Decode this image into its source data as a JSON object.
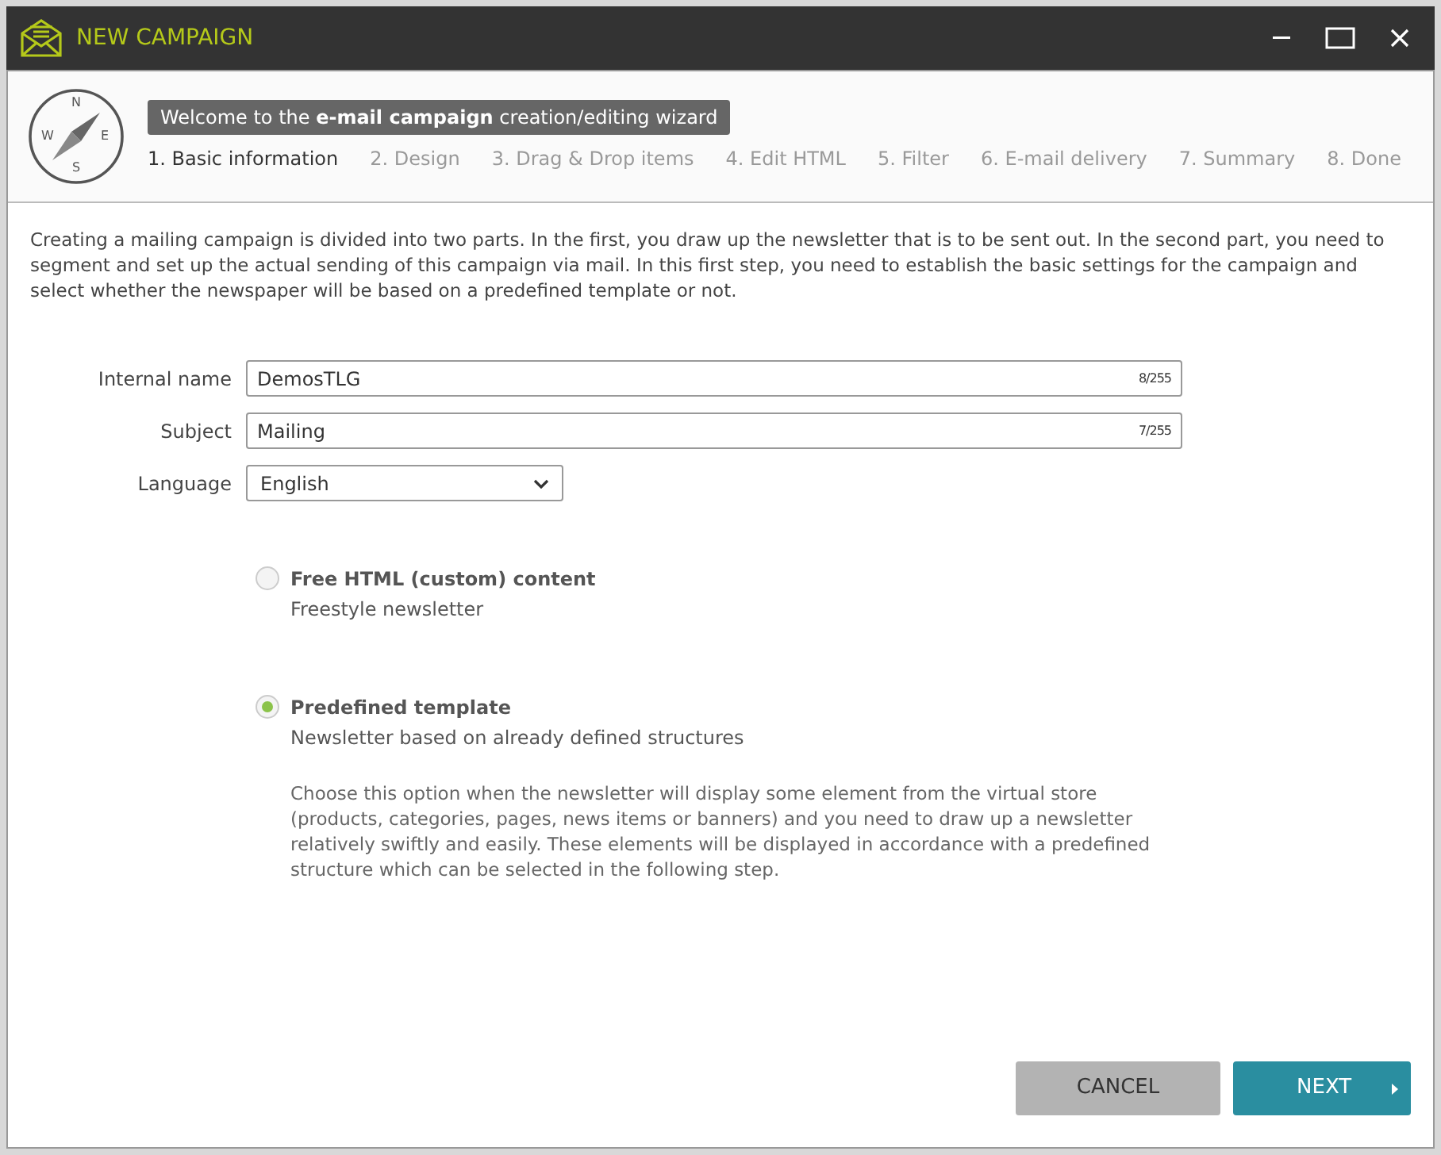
{
  "window": {
    "title": "NEW CAMPAIGN"
  },
  "wizard": {
    "welcome": "Welcome to the **e-mail campaign** creation/editing wizard",
    "compass_letters": [
      "N",
      "E",
      "S",
      "W"
    ],
    "steps": [
      {
        "label": "1. Basic information",
        "selected": true
      },
      {
        "label": "2. Design",
        "selected": false
      },
      {
        "label": "3. Drag & Drop items",
        "selected": false
      },
      {
        "label": "4. Edit HTML",
        "selected": false
      },
      {
        "label": "5. Filter",
        "selected": false
      },
      {
        "label": "6. E-mail delivery",
        "selected": false
      },
      {
        "label": "7. Summary",
        "selected": false
      },
      {
        "label": "8. Done",
        "selected": false
      }
    ]
  },
  "intro": "Creating a mailing campaign is divided into two parts. In the first, you draw up the newsletter that is to be sent out. In the second part, you need to segment and set up the actual sending of this campaign via mail. In this first step, you need to establish the basic settings for the campaign and select whether the newspaper will be based on a predefined template or not.",
  "fields": [
    {
      "kind": "text",
      "label": "Internal name",
      "value": "DemosTLG",
      "counter": "8/255"
    },
    {
      "kind": "text",
      "label": "Subject",
      "value": "Mailing",
      "counter": "7/255"
    },
    {
      "kind": "select",
      "label": "Language",
      "value": "English"
    }
  ],
  "options": [
    {
      "title": "Free HTML (custom) content",
      "subtitle": "Freestyle newsletter",
      "selected": false
    },
    {
      "title": "Predefined template",
      "subtitle": "Newsletter based on already defined structures",
      "selected": true,
      "note": "Choose this option when the newsletter will display some element from the virtual store (products, categories, pages, news items or banners) and you need to draw up a newsletter relatively swiftly and easily. These elements will be displayed in accordance with a predefined structure which can be selected in the following step."
    }
  ],
  "buttons": [
    {
      "kind": "cancel",
      "label": "CANCEL"
    },
    {
      "kind": "next",
      "label": "NEXT"
    }
  ]
}
